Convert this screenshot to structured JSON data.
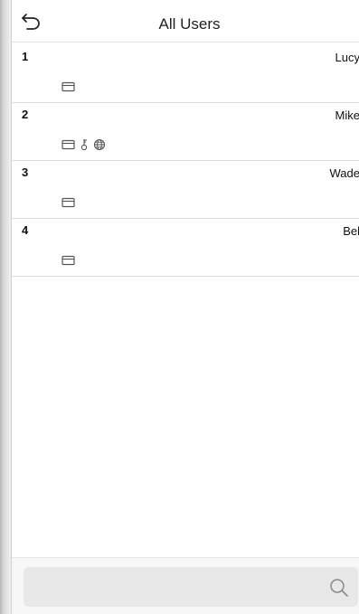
{
  "header": {
    "title": "All Users",
    "back_icon": "back-arrow-icon"
  },
  "users": [
    {
      "id": "1",
      "name": "Lucy",
      "icons": [
        "card-icon"
      ]
    },
    {
      "id": "2",
      "name": "Mike",
      "icons": [
        "card-icon",
        "key-icon",
        "globe-icon"
      ]
    },
    {
      "id": "3",
      "name": "Wade",
      "icons": [
        "card-icon"
      ]
    },
    {
      "id": "4",
      "name": "Bel",
      "icons": [
        "card-icon"
      ]
    }
  ],
  "search": {
    "placeholder": "",
    "icon": "search-icon"
  }
}
